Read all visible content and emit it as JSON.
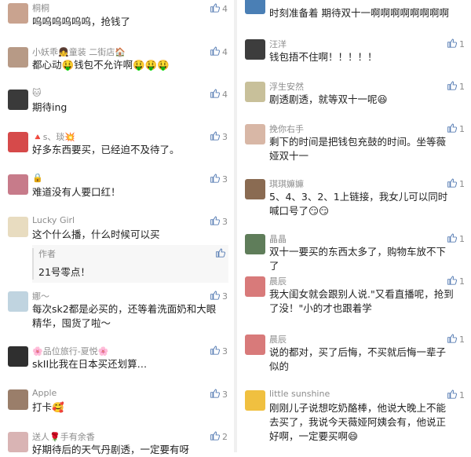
{
  "left_comments": [
    {
      "name": "桐桐",
      "text": "呜呜呜呜呜呜，抢钱了",
      "likes": "4",
      "avatar_color": "#c9a38f"
    },
    {
      "name": "小妖乖👧童装 二街店🏠",
      "text": "都心动🤑钱包不允许啊🤑🤑🤑",
      "likes": "4",
      "avatar_color": "#b79a86"
    },
    {
      "name": "🐱",
      "text": "期待ing",
      "likes": "4",
      "avatar_color": "#3a3a3a"
    },
    {
      "name": "🔺s、琰💥",
      "text": "好多东西要买，已经迫不及待了。",
      "likes": "3",
      "avatar_color": "#d64a4a"
    },
    {
      "name": "🔒",
      "text": "难道没有人要口红！",
      "likes": "3",
      "avatar_color": "#c77b8a"
    },
    {
      "name": "Lucky Girl",
      "text": "这个什么播，什么时候可以买",
      "likes": "3",
      "avatar_color": "#e8dcc0"
    },
    {
      "name": "娜～",
      "text": "每次sk2都是必买的，还等着洗面奶和大眼精华，囤货了啦～",
      "likes": "3",
      "avatar_color": "#c0d4e0"
    },
    {
      "name": "🌸品位旅行-夏悦🌸",
      "text": "skII比我在日本买还划算…",
      "likes": "3",
      "avatar_color": "#2f2f2f"
    },
    {
      "name": "Apple",
      "text": "打卡🥰",
      "likes": "3",
      "avatar_color": "#9a7e6a"
    },
    {
      "name": "送人🌹手有余香",
      "text": "好期待后的天气丹剧透，一定要有呀",
      "likes": "2",
      "avatar_color": "#d9b4b4"
    }
  ],
  "reply": {
    "author": "作者",
    "text": "21号零点！"
  },
  "right_comments": [
    {
      "name": "",
      "text": "时刻准备着  期待双十一啊啊啊啊啊啊啊啊",
      "likes": "",
      "avatar_color": "#4a7fb5"
    },
    {
      "name": "汪洋",
      "text": "钱包捂不住啊！！！！！",
      "likes": "1",
      "avatar_color": "#3d3d3d"
    },
    {
      "name": "浮生安然",
      "text": "剧透剧透，就等双十一呢😆",
      "likes": "1",
      "avatar_color": "#c8c09a"
    },
    {
      "name": "挽你右手",
      "text": "剩下的时间是把钱包充鼓的时间。坐等薇娅双十一",
      "likes": "1",
      "avatar_color": "#d8b7a6"
    },
    {
      "name": "琪琪嫲嫲",
      "text": "5、4、3、2、1上链接，我女儿可以同时喊口号了😏😏",
      "likes": "1",
      "avatar_color": "#8a6b52"
    },
    {
      "name": "晶晶",
      "text": "双十一要买的东西太多了，购物车放不下了",
      "likes": "1",
      "avatar_color": "#5f7d5a"
    },
    {
      "name": "晨辰",
      "text": "我大闺女就会跟别人说.\"又看直播呢，抢到了没！\"小的才也跟着学",
      "likes": "1",
      "avatar_color": "#d87a7a"
    },
    {
      "name": "晨辰",
      "text": "说的都对，买了后悔，不买就后悔一辈子似的",
      "likes": "1",
      "avatar_color": "#d87a7a"
    },
    {
      "name": "little sunshine",
      "text": "刚刚儿子说想吃奶酪棒，他说大晚上不能去买了，我说今天薇娅阿姨会有，他说正好啊，一定要买啊😄",
      "likes": "1",
      "avatar_color": "#f0c040"
    }
  ],
  "icons": {
    "like": "thumbs-up-icon"
  },
  "colors": {
    "like": "#5a7fb5",
    "name": "#8c8c8c"
  }
}
